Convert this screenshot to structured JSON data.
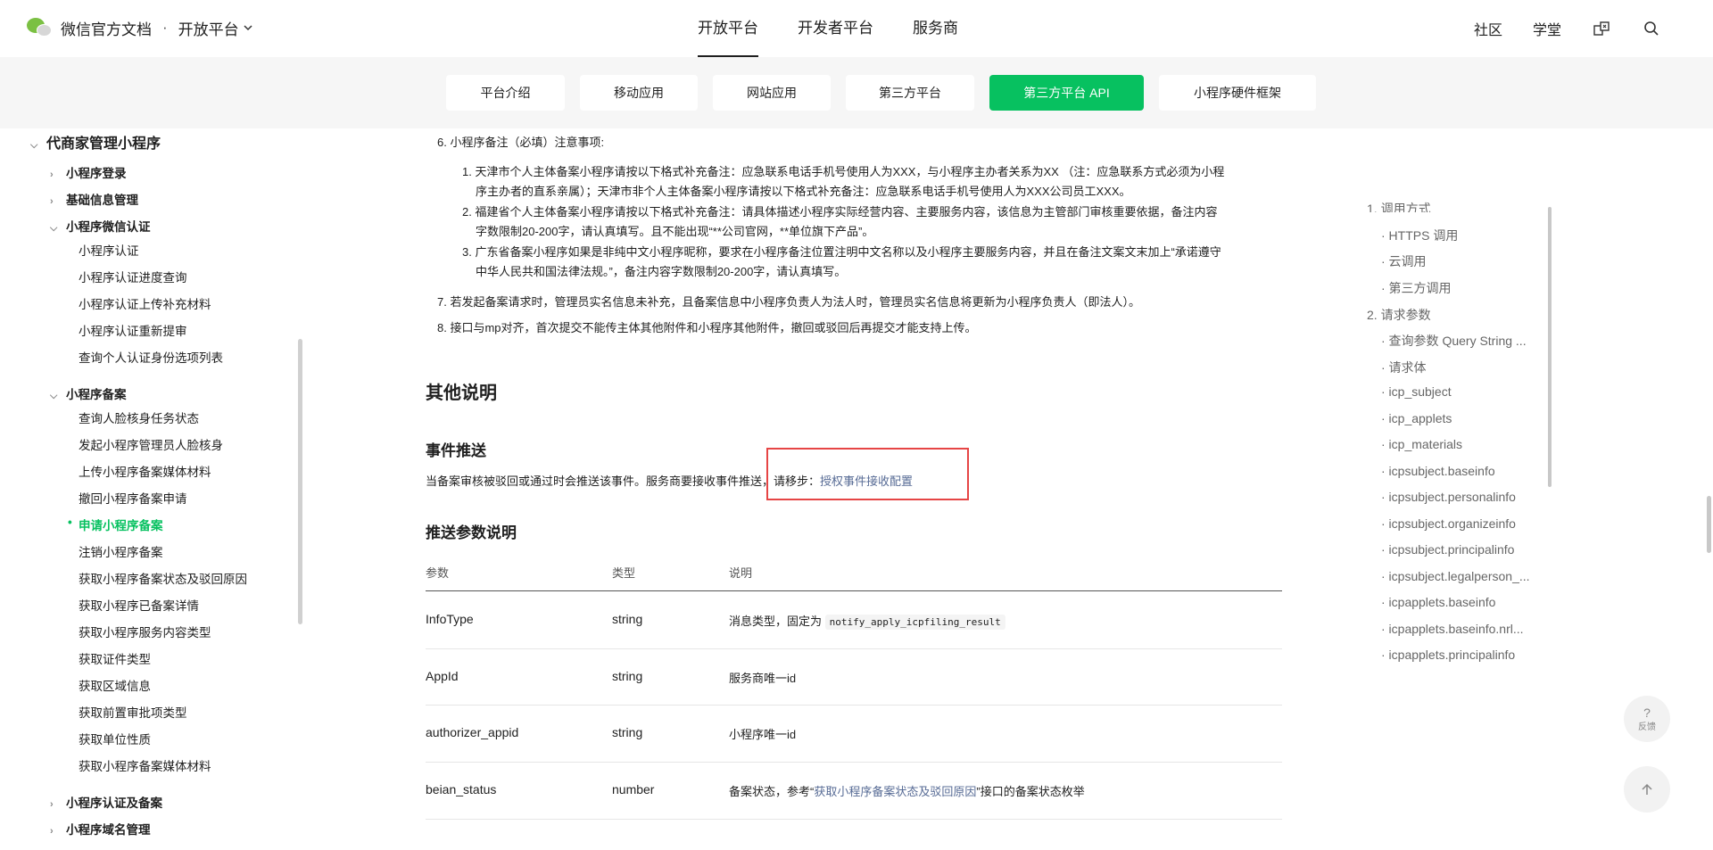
{
  "header": {
    "brand_title": "微信官方文档",
    "dot": "·",
    "platform_label": "开放平台",
    "nav": [
      "开放平台",
      "开发者平台",
      "服务商"
    ],
    "right_links": [
      "社区",
      "学堂"
    ]
  },
  "subnav": {
    "tabs": [
      "平台介绍",
      "移动应用",
      "网站应用",
      "第三方平台",
      "第三方平台 API",
      "小程序硬件框架"
    ],
    "active_index": 4
  },
  "sidebar": {
    "top": "代商家管理小程序",
    "groups": [
      {
        "label": "小程序登录"
      },
      {
        "label": "基础信息管理"
      },
      {
        "label": "小程序微信认证",
        "items": [
          "小程序认证",
          "小程序认证进度查询",
          "小程序认证上传补充材料",
          "小程序认证重新提审",
          "查询个人认证身份选项列表"
        ]
      },
      {
        "label": "小程序备案",
        "items": [
          "查询人脸核身任务状态",
          "发起小程序管理员人脸核身",
          "上传小程序备案媒体材料",
          "撤回小程序备案申请",
          "申请小程序备案",
          "注销小程序备案",
          "获取小程序备案状态及驳回原因",
          "获取小程序已备案详情",
          "获取小程序服务内容类型",
          "获取证件类型",
          "获取区域信息",
          "获取前置审批项类型",
          "获取单位性质",
          "获取小程序备案媒体材料"
        ]
      },
      {
        "label": "小程序认证及备案"
      },
      {
        "label": "小程序域名管理"
      }
    ],
    "active_item": "申请小程序备案"
  },
  "content": {
    "item6": "6. 小程序备注（必填）注意事项:",
    "sub1a": "1. 天津市个人主体备案小程序请按以下格式补充备注：应急联系电话手机号使用人为XXX，与小程序主办者关系为XX （注：应急联系方式必须为小程",
    "sub1b": "序主办者的直系亲属）；天津市非个人主体备案小程序请按以下格式补充备注：应急联系电话手机号使用人为XXX公司员工XXX。",
    "sub2a": "2. 福建省个人主体备案小程序请按以下格式补充备注：请具体描述小程序实际经营内容、主要服务内容，该信息为主管部门审核重要依据，备注内容",
    "sub2b": "字数限制20-200字，请认真填写。且不能出现“**公司官网，**单位旗下产品”。",
    "sub3a": "3. 广东省备案小程序如果是非纯中文小程序昵称，要求在小程序备注位置注明中文名称以及小程序主要服务内容，并且在备注文案文末加上“承诺遵守",
    "sub3b": "中华人民共和国法律法规。”，备注内容字数限制20-200字，请认真填写。",
    "item7": "7. 若发起备案请求时，管理员实名信息未补充，且备案信息中小程序负责人为法人时，管理员实名信息将更新为小程序负责人（即法人）。",
    "item8": "8. 接口与mp对齐，首次提交不能传主体其他附件和小程序其他附件，撤回或驳回后再提交才能支持上传。",
    "other_title": "其他说明",
    "event_title": "事件推送",
    "event_text": "当备案审核被驳回或通过时会推送该事件。服务商要接收事件推送，请移步：",
    "event_link": "授权事件接收配置",
    "params_title": "推送参数说明"
  },
  "table": {
    "headers": [
      "参数",
      "类型",
      "说明"
    ],
    "rows": [
      {
        "param": "InfoType",
        "type": "string",
        "desc_prefix": "消息类型，固定为",
        "desc_code": "notify_apply_icpfiling_result",
        "desc_link": "",
        "desc_suffix": ""
      },
      {
        "param": "AppId",
        "type": "string",
        "desc_prefix": "服务商唯一id",
        "desc_code": "",
        "desc_link": "",
        "desc_suffix": ""
      },
      {
        "param": "authorizer_appid",
        "type": "string",
        "desc_prefix": "小程序唯一id",
        "desc_code": "",
        "desc_link": "",
        "desc_suffix": ""
      },
      {
        "param": "beian_status",
        "type": "number",
        "desc_prefix": "备案状态，参考“",
        "desc_code": "",
        "desc_link": "获取小程序备案状态及驳回原因",
        "desc_suffix": "”接口的备案状态枚举"
      }
    ]
  },
  "toc": {
    "items": [
      "1. 调用方式",
      "· HTTPS 调用",
      "· 云调用",
      "· 第三方调用",
      "2. 请求参数",
      "· 查询参数 Query String ...",
      "· 请求体",
      "· icp_subject",
      "· icp_applets",
      "· icp_materials",
      "· icpsubject.baseinfo",
      "· icpsubject.personalinfo",
      "· icpsubject.organizeinfo",
      "· icpsubject.principalinfo",
      "· icpsubject.legalperson_...",
      "· icpapplets.baseinfo",
      "· icpapplets.baseinfo.nrl...",
      "· icpapplets.principalinfo"
    ]
  },
  "float": {
    "feedback_q": "?",
    "feedback_label": "反馈"
  },
  "colors": {
    "accent": "#07c160",
    "link": "#576b95",
    "highlight": "#e64545"
  }
}
